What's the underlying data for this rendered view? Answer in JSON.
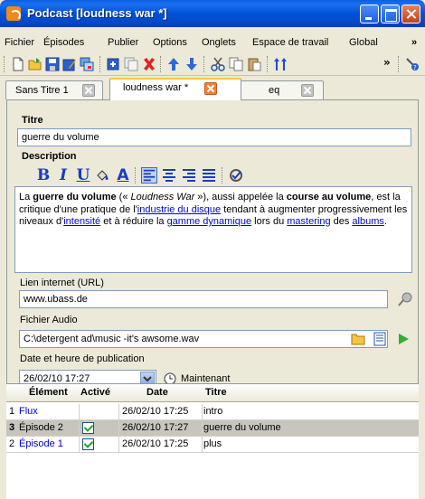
{
  "window": {
    "title": "Podcast [loudness war *]"
  },
  "menu": [
    "Fichier",
    "Épisodes",
    "Publier",
    "Options",
    "Onglets",
    "Espace de travail",
    "Global",
    "»"
  ],
  "toolbar": {
    "icons": [
      "new-icon",
      "open-icon",
      "save-icon",
      "edit-icon",
      "windows-icon",
      "add-icon",
      "copy-page-icon",
      "delete-icon",
      "up-arrow-icon",
      "down-arrow-icon",
      "cut-icon",
      "copy-icon",
      "paste-icon",
      "sort-icon",
      "overflow-icon",
      "help-icon"
    ],
    "overflow_label": "»"
  },
  "tabs": [
    {
      "label": "Sans Titre 1",
      "active": false
    },
    {
      "label": "loudness war *",
      "active": true
    },
    {
      "label": "eq",
      "active": false
    }
  ],
  "form": {
    "title_label": "Titre",
    "title_value": "guerre du volume",
    "description_label": "Description",
    "format_buttons": {
      "bold": "B",
      "italic": "I",
      "underline": "U",
      "color": "A"
    },
    "description": {
      "p1": "La ",
      "b1": "guerre du volume",
      "p2": " (« ",
      "i1": "Loudness War",
      "p3": " »), aussi appelée la ",
      "b2": "course au volume",
      "p4": ", est la critique d'une pratique de l'",
      "a1": "industrie du disque",
      "p5": " tendant à augmenter progressivement les niveaux d'",
      "a2": "intensité",
      "p6": " et à réduire la ",
      "a3": "gamme dynamique",
      "p7": " lors du ",
      "a4": "mastering",
      "p8": " des ",
      "a5": "albums",
      "p9": "."
    },
    "url_label": "Lien internet (URL)",
    "url_value": "www.ubass.de",
    "audio_label": "Fichier Audio",
    "audio_value": "C:\\detergent ad\\music -it's awsome.wav",
    "date_label": "Date et heure de publication",
    "date_value": "26/02/10 17:27",
    "now_label": "Maintenant"
  },
  "table": {
    "headers": [
      "Élément",
      "Activé",
      "Date",
      "Titre"
    ],
    "rows": [
      {
        "num": "1",
        "element": "Flux",
        "active": false,
        "date": "26/02/10 17:25",
        "title": "intro",
        "selected": false
      },
      {
        "num": "3",
        "element": "Épisode 2",
        "active": true,
        "date": "26/02/10 17:27",
        "title": "guerre du volume",
        "selected": true
      },
      {
        "num": "2",
        "element": "Épisode 1",
        "active": true,
        "date": "26/02/10 17:25",
        "title": "plus",
        "selected": false
      }
    ]
  }
}
